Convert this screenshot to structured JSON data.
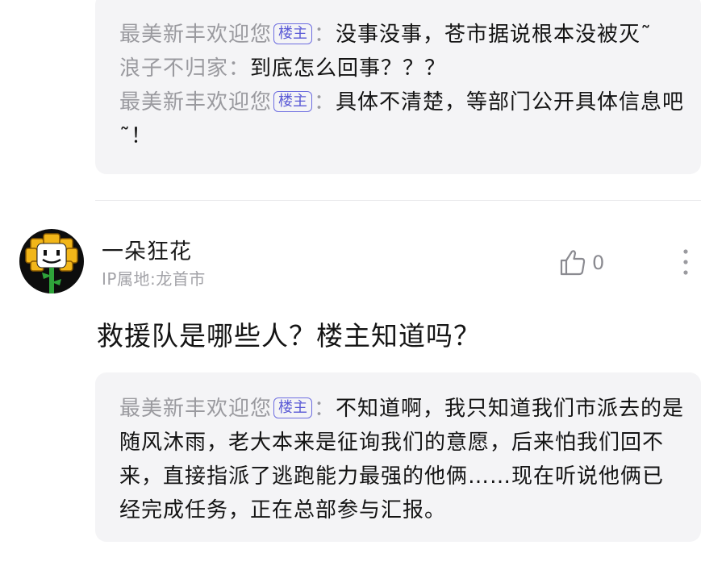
{
  "thread_top": {
    "replies": [
      {
        "user": "最美新丰欢迎您",
        "badge": "楼主",
        "sep": "：",
        "text": "没事没事，苍市据说根本没被灭˜"
      },
      {
        "user": "浪子不归家",
        "badge": "",
        "sep": "：",
        "text": "到底怎么回事？？？"
      },
      {
        "user": "最美新丰欢迎您",
        "badge": "楼主",
        "sep": "：",
        "text": "具体不清楚，等部门公开具体信息吧˜！"
      }
    ]
  },
  "comment": {
    "username": "一朵狂花",
    "ip_location": "IP属地:龙首市",
    "like_count": "0",
    "like_icon": "thumb-up-icon",
    "more_icon": "more-vertical-icon",
    "avatar_icon": "flower-avatar",
    "text": "救援队是哪些人？楼主知道吗？",
    "replies": [
      {
        "user": "最美新丰欢迎您",
        "badge": "楼主",
        "sep": "：",
        "text": "不知道啊，我只知道我们市派去的是随风沐雨，老大本来是征询我们的意愿，后来怕我们回不来，直接指派了逃跑能力最强的他俩……现在听说他俩已经完成任务，正在总部参与汇报。"
      }
    ]
  },
  "colors": {
    "accent_badge": "#5a5ad6",
    "reply_bg": "#f4f4f6",
    "muted_text": "#9a9a9f"
  }
}
